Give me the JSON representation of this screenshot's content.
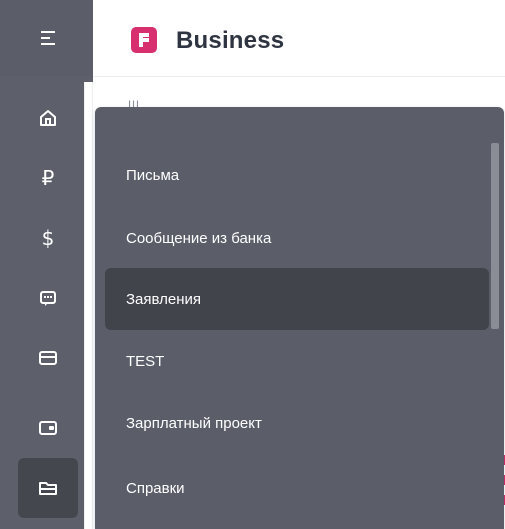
{
  "header": {
    "brand": "Business",
    "logo_color": "#d6306e"
  },
  "rail": {
    "items": [
      {
        "name": "menu-toggle",
        "icon": "hamburger-icon"
      },
      {
        "name": "home",
        "icon": "home-icon"
      },
      {
        "name": "rub",
        "icon": "ruble-icon",
        "glyph": "₽"
      },
      {
        "name": "usd",
        "icon": "dollar-icon",
        "glyph": "$"
      },
      {
        "name": "chat",
        "icon": "chat-icon"
      },
      {
        "name": "cards",
        "icon": "card-icon"
      },
      {
        "name": "wallet",
        "icon": "wallet-icon"
      },
      {
        "name": "documents",
        "icon": "folder-icon",
        "active": true
      }
    ]
  },
  "background": {
    "peek_text": "Ш..."
  },
  "menu": {
    "items": [
      {
        "label": "Письма"
      },
      {
        "label": "Сообщение из банка"
      },
      {
        "label": "Заявления",
        "selected": true
      },
      {
        "label": "TEST"
      },
      {
        "label": "Зарплатный проект"
      },
      {
        "label": "Справки"
      }
    ]
  },
  "colors": {
    "rail_bg": "#5d606b",
    "menu_bg": "#5b5e69",
    "selected_bg": "#42444c",
    "brand_text": "#2f3441"
  }
}
